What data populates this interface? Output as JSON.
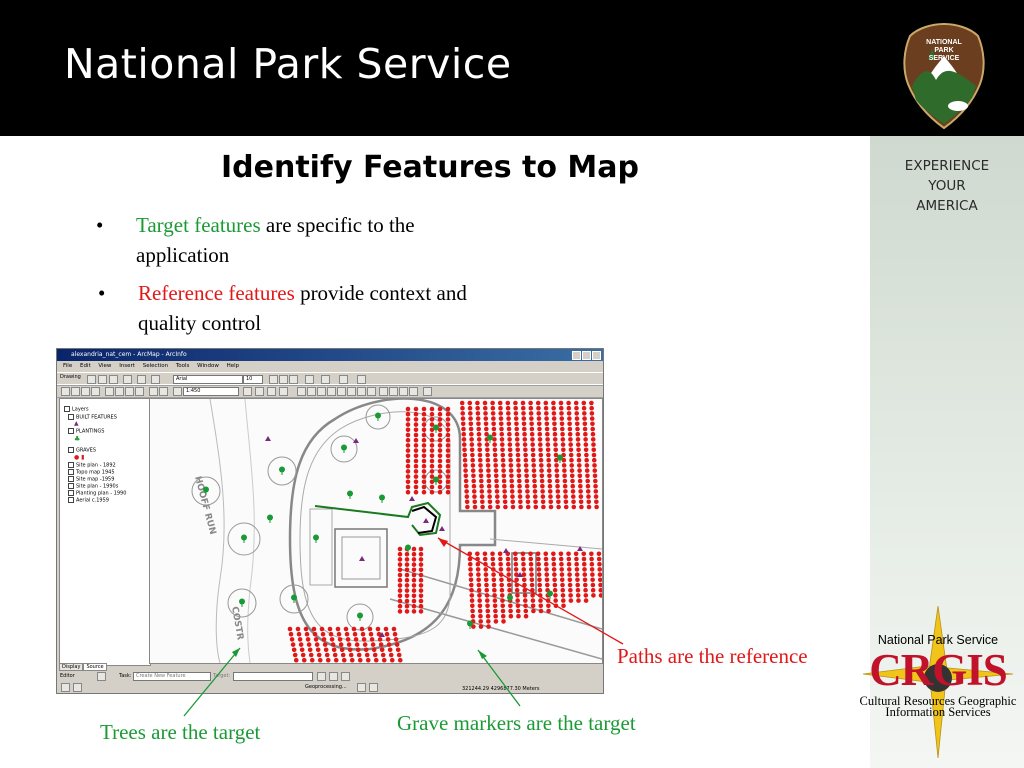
{
  "header": {
    "title": "National Park Service",
    "logo_text": [
      "NATIONAL",
      "PARK",
      "SERVICE"
    ]
  },
  "sidebar": {
    "tagline": [
      "EXPERIENCE",
      "YOUR",
      "AMERICA"
    ]
  },
  "slide": {
    "title": "Identify Features to Map",
    "bullet_char": "•",
    "bullets": [
      {
        "highlight": "Target features",
        "rest": " are specific to the application",
        "color": "#1a9a35"
      },
      {
        "highlight": "Reference features",
        "rest": " provide context and quality control",
        "color": "#e01818"
      }
    ]
  },
  "arcmap": {
    "window_title": "alexandria_nat_cem - ArcMap - ArcInfo",
    "menus": [
      "File",
      "Edit",
      "View",
      "Insert",
      "Selection",
      "Tools",
      "Window",
      "Help"
    ],
    "drawing_label": "Drawing",
    "font_value": "Arial",
    "font_size": "10",
    "scale_value": "1:450",
    "toc": {
      "items": [
        "Layers",
        "BUILT FEATURES",
        "PLANTINGS",
        "GRAVES",
        "Site plan - 1892",
        "Topo map 1945",
        "Site map -1959",
        "Site plan - 1990s",
        "Planting plan - 1990",
        "Aerial c.1959"
      ],
      "tabs": [
        "Display",
        "Source"
      ]
    },
    "map_labels": [
      "HOOFF RUN",
      "COSTR"
    ],
    "editor_label": "Editor",
    "task_label": "Task:",
    "task_value": "Create New Feature",
    "target_label": "Target:",
    "geoprocessing": "Geoprocessing...",
    "coordinates": "321244.29  4296877.30 Meters"
  },
  "callouts": {
    "paths": "Paths are the reference",
    "trees": "Trees are the target",
    "graves": "Grave markers are the target"
  },
  "crgis": {
    "name": "National Park Service",
    "big": "CRGIS",
    "sub1": "Cultural Resources Geographic",
    "sub2": "Information Services"
  },
  "colors": {
    "target_green": "#1a9a35",
    "reference_red": "#e01818",
    "header_bg": "#000000",
    "crgis_red": "#c0122a"
  }
}
